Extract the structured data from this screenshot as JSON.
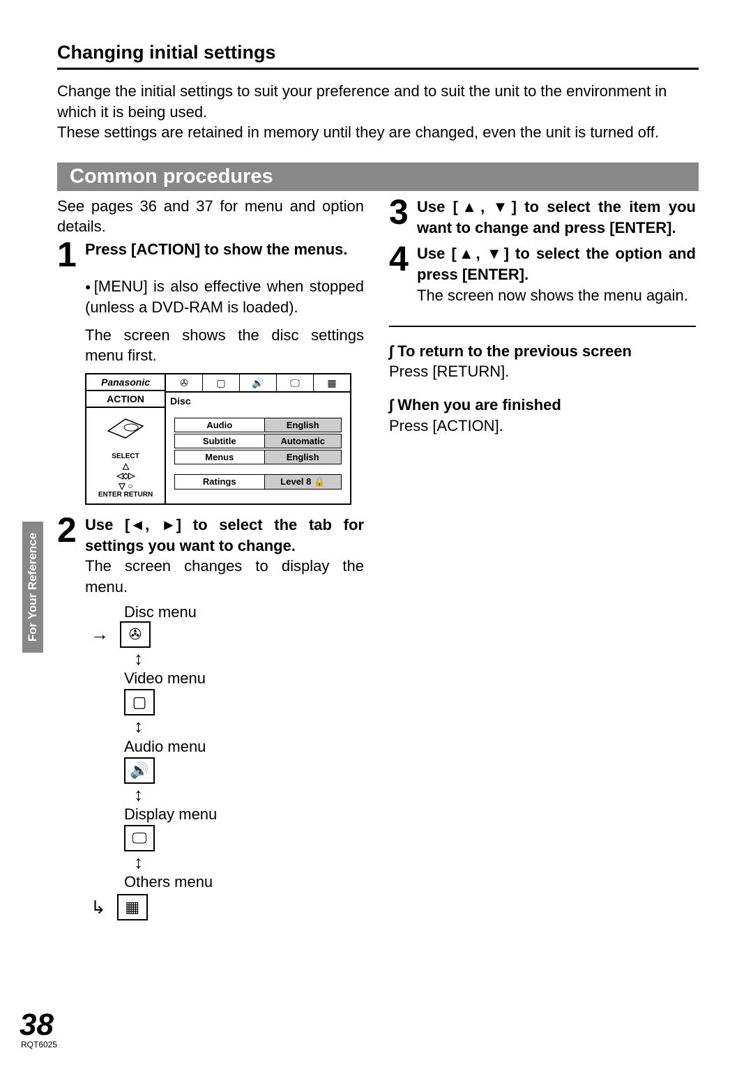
{
  "header": {
    "section_title": "Changing initial settings",
    "intro_1": "Change the initial settings to suit your preference and to suit the unit to the environment in which it is being used.",
    "intro_2": "These settings are retained in memory until they are changed, even the unit is turned off."
  },
  "bar": "Common procedures",
  "left": {
    "see_pages": "See pages 36 and 37 for menu and option details.",
    "step1": {
      "num": "1",
      "title": "Press [ACTION] to show the menus.",
      "bullet": "[MENU] is also effective when stopped (unless a DVD-RAM is loaded).",
      "note": "The screen shows the disc settings menu first."
    },
    "screen": {
      "brand": "Panasonic",
      "action": "ACTION",
      "select": "SELECT",
      "enter": "ENTER",
      "return": "RETURN",
      "disc": "Disc",
      "rows": [
        {
          "key": "Audio",
          "val": "English"
        },
        {
          "key": "Subtitle",
          "val": "Automatic"
        },
        {
          "key": "Menus",
          "val": "English"
        },
        {
          "key": "Ratings",
          "val": "Level 8 🔒"
        }
      ]
    },
    "step2": {
      "num": "2",
      "title": "Use [◄, ►] to select the tab for settings you want to change.",
      "note": "The screen changes to display the menu."
    },
    "flow": {
      "disc": "Disc menu",
      "video": "Video menu",
      "audio": "Audio menu",
      "display": "Display menu",
      "others": "Others menu"
    }
  },
  "right": {
    "step3": {
      "num": "3",
      "title": "Use [▲, ▼] to select the item you want to change and press [ENTER]."
    },
    "step4": {
      "num": "4",
      "title": "Use [▲, ▼] to select the option and press [ENTER].",
      "note": "The screen now shows the menu again."
    },
    "note1_title": "To return to the previous screen",
    "note1_body": "Press [RETURN].",
    "note2_title": "When you are finished",
    "note2_body": "Press [ACTION]."
  },
  "side_tab": "For Your Reference",
  "page_number": "38",
  "doc_code": "RQT6025"
}
